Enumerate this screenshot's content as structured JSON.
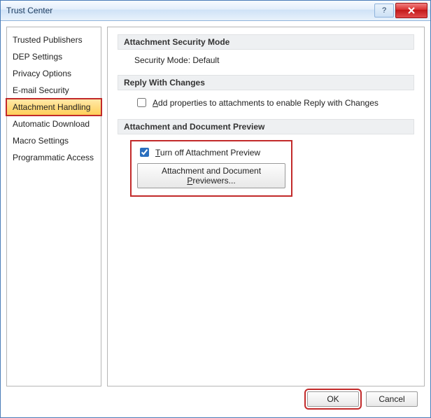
{
  "window": {
    "title": "Trust Center"
  },
  "sidebar": {
    "items": [
      {
        "label": "Trusted Publishers"
      },
      {
        "label": "DEP Settings"
      },
      {
        "label": "Privacy Options"
      },
      {
        "label": "E-mail Security"
      },
      {
        "label": "Attachment Handling"
      },
      {
        "label": "Automatic Download"
      },
      {
        "label": "Macro Settings"
      },
      {
        "label": "Programmatic Access"
      }
    ],
    "selected_index": 4
  },
  "sections": {
    "securityMode": {
      "header": "Attachment Security Mode",
      "modeLabel": "Security Mode:",
      "modeValue": "Default"
    },
    "replyChanges": {
      "header": "Reply With Changes",
      "checkboxLabel": "Add properties to attachments to enable Reply with Changes",
      "checked": false
    },
    "preview": {
      "header": "Attachment and Document Preview",
      "turnOffLabel": "Turn off Attachment Preview",
      "turnOffChecked": true,
      "previewersButton": "Attachment and Document Previewers..."
    }
  },
  "footer": {
    "ok": "OK",
    "cancel": "Cancel"
  }
}
